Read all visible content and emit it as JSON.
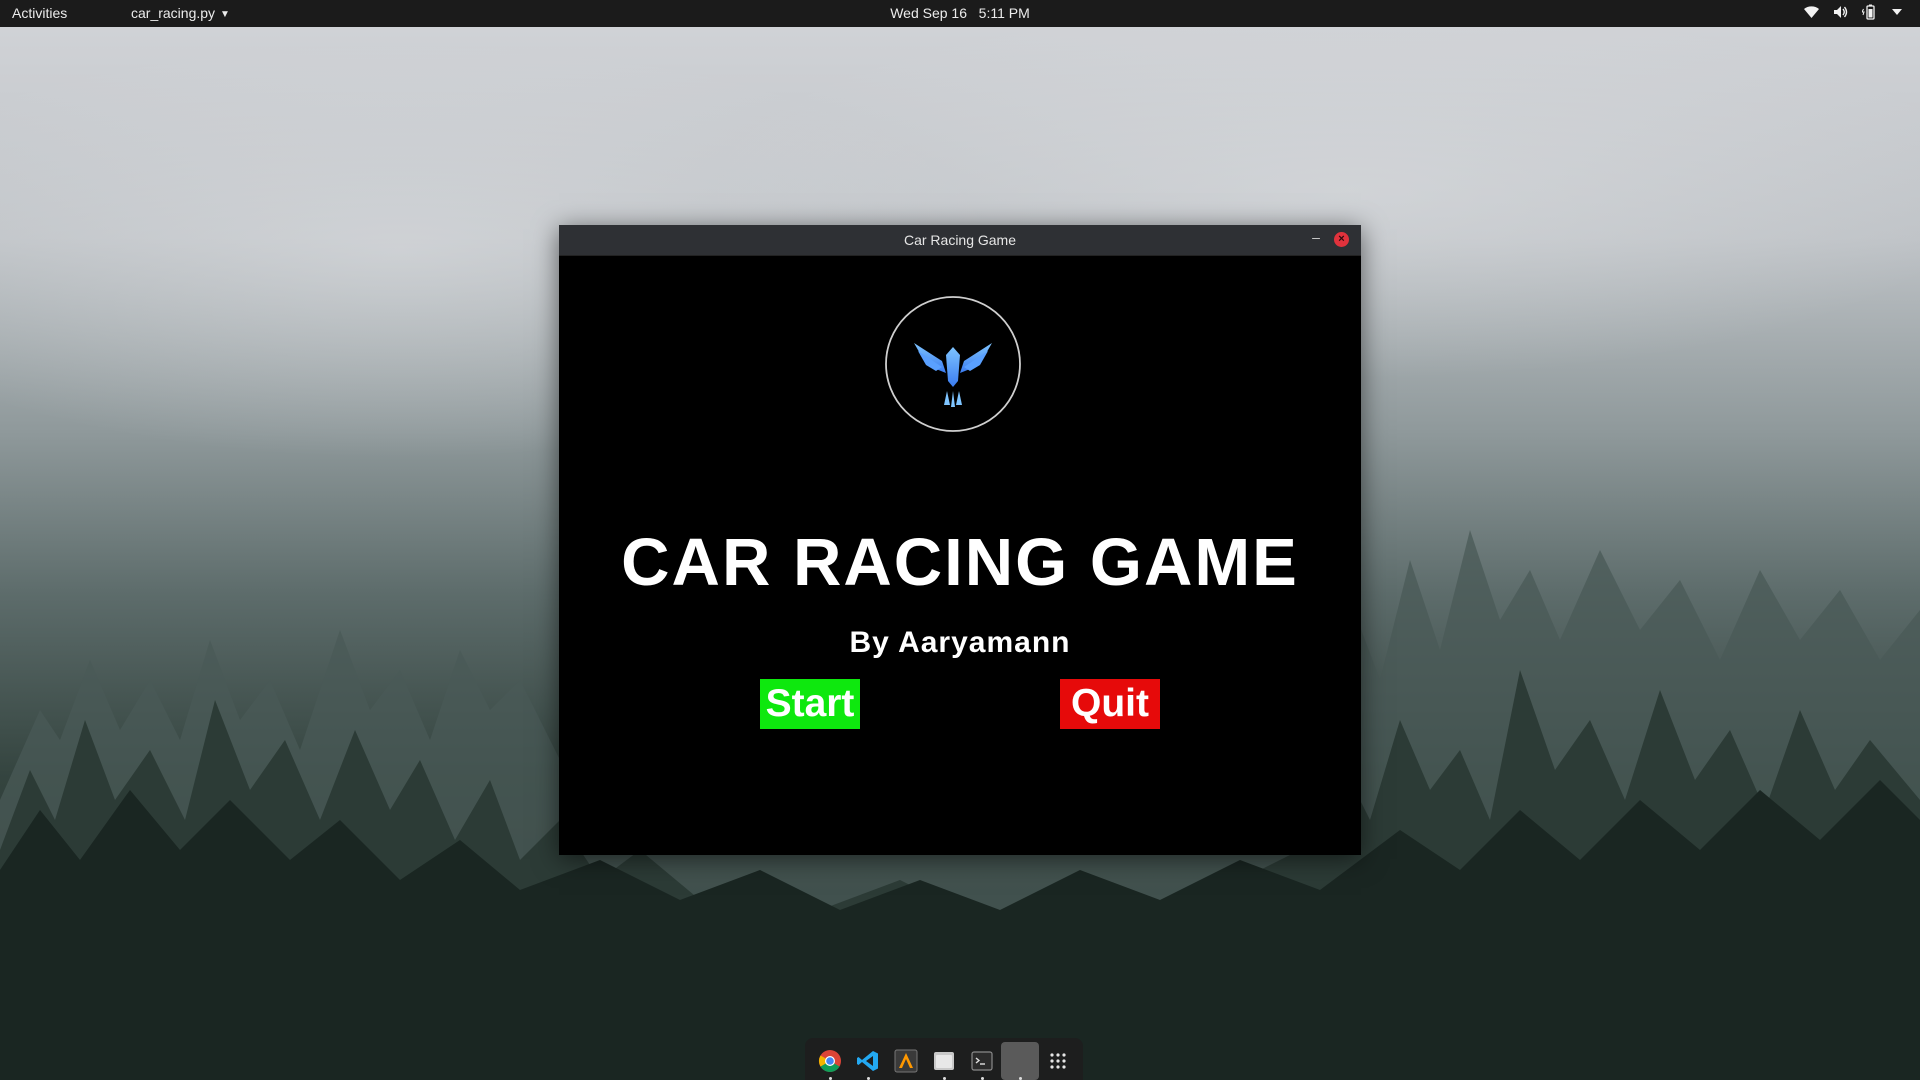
{
  "topbar": {
    "activities_label": "Activities",
    "app_menu_label": "car_racing.py",
    "date": "Wed Sep 16",
    "time": "5:11 PM",
    "tray_icons": [
      "wifi-icon",
      "volume-icon",
      "battery-icon",
      "menu-caret-icon"
    ]
  },
  "window": {
    "title": "Car Racing Game",
    "minimize_glyph": "–",
    "close_glyph": "×"
  },
  "game": {
    "title": "CAR RACING GAME",
    "byline": "By Aaryamann",
    "start_label": "Start",
    "quit_label": "Quit",
    "logo": "eagle-logo-icon",
    "colors": {
      "start_bg": "#0ee80e",
      "quit_bg": "#e60a0a",
      "background": "#000000",
      "logo_blue": "#4fa8ff"
    }
  },
  "dock": {
    "items": [
      {
        "name": "chrome-icon",
        "running": true
      },
      {
        "name": "vscode-icon",
        "running": true
      },
      {
        "name": "sublime-icon",
        "running": false
      },
      {
        "name": "files-icon",
        "running": true
      },
      {
        "name": "terminal-icon",
        "running": true
      },
      {
        "name": "python-window-icon",
        "running": true
      },
      {
        "name": "app-grid-icon",
        "running": false
      }
    ]
  }
}
